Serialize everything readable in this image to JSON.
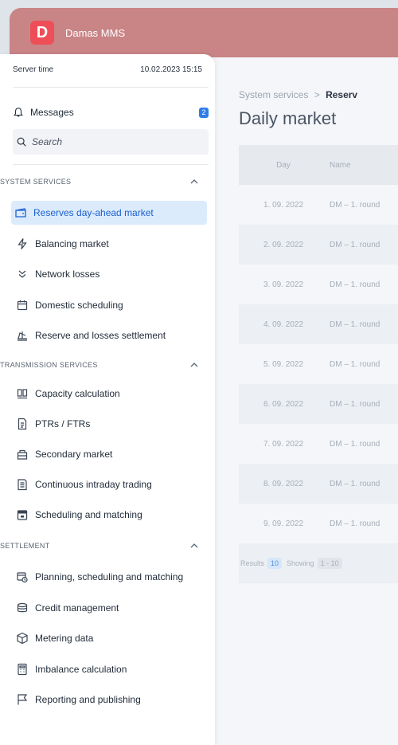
{
  "app": {
    "logo_letter": "D",
    "name": "Damas MMS"
  },
  "server": {
    "label": "Server time",
    "datetime": "10.02.2023 15:15"
  },
  "messages": {
    "label": "Messages",
    "count": "2"
  },
  "search": {
    "placeholder": "Search"
  },
  "sections": {
    "system": "SYSTEM SERVICES",
    "transmission": "TRANSMISSION SERVICES",
    "settlement": "SETTLEMENT"
  },
  "nav": {
    "system": [
      {
        "label": "Reserves day-ahead market",
        "icon": "wallet-icon",
        "active": true
      },
      {
        "label": "Balancing market",
        "icon": "lightning-icon"
      },
      {
        "label": "Network losses",
        "icon": "chevrons-down-icon"
      },
      {
        "label": "Domestic scheduling",
        "icon": "calendar-icon"
      },
      {
        "label": "Reserve and losses settlement",
        "icon": "scales-icon"
      }
    ],
    "transmission": [
      {
        "label": "Capacity calculation",
        "icon": "grid-icon"
      },
      {
        "label": "PTRs / FTRs",
        "icon": "document-icon"
      },
      {
        "label": "Secondary market",
        "icon": "shop-icon"
      },
      {
        "label": "Continuous intraday trading",
        "icon": "file-list-icon"
      },
      {
        "label": "Scheduling and matching",
        "icon": "calendar-filled-icon"
      }
    ],
    "settlement": [
      {
        "label": "Planning, scheduling and matching",
        "icon": "calendar-clock-icon"
      },
      {
        "label": "Credit management",
        "icon": "money-icon"
      },
      {
        "label": "Metering data",
        "icon": "cube-icon"
      },
      {
        "label": "Imbalance calculation",
        "icon": "calculator-icon"
      },
      {
        "label": "Reporting and publishing",
        "icon": "flag-icon"
      }
    ]
  },
  "main": {
    "breadcrumb_parent": "System services",
    "breadcrumb_sep": ">",
    "breadcrumb_current": "Reserv",
    "title": "Daily market",
    "columns": {
      "day": "Day",
      "name": "Name"
    },
    "rows": [
      {
        "day": "1. 09. 2022",
        "name": "DM – 1. round"
      },
      {
        "day": "2. 09. 2022",
        "name": "DM – 1. round"
      },
      {
        "day": "3. 09. 2022",
        "name": "DM – 1. round"
      },
      {
        "day": "4. 09. 2022",
        "name": "DM – 1. round"
      },
      {
        "day": "5. 09. 2022",
        "name": "DM – 1. round"
      },
      {
        "day": "6. 09. 2022",
        "name": "DM – 1. round"
      },
      {
        "day": "7. 09. 2022",
        "name": "DM – 1. round"
      },
      {
        "day": "8. 09. 2022",
        "name": "DM – 1. round"
      },
      {
        "day": "9. 09. 2022",
        "name": "DM – 1. round"
      }
    ],
    "footer": {
      "results_label": "Results",
      "results_count": "10",
      "showing_label": "Showing",
      "showing_range": "1 - 10"
    }
  },
  "colors": {
    "topbar": "#c98486",
    "logo": "#ee4e57",
    "active_bg": "#dcebfb",
    "active_text": "#1b5fd0",
    "badge": "#2e7de8"
  }
}
